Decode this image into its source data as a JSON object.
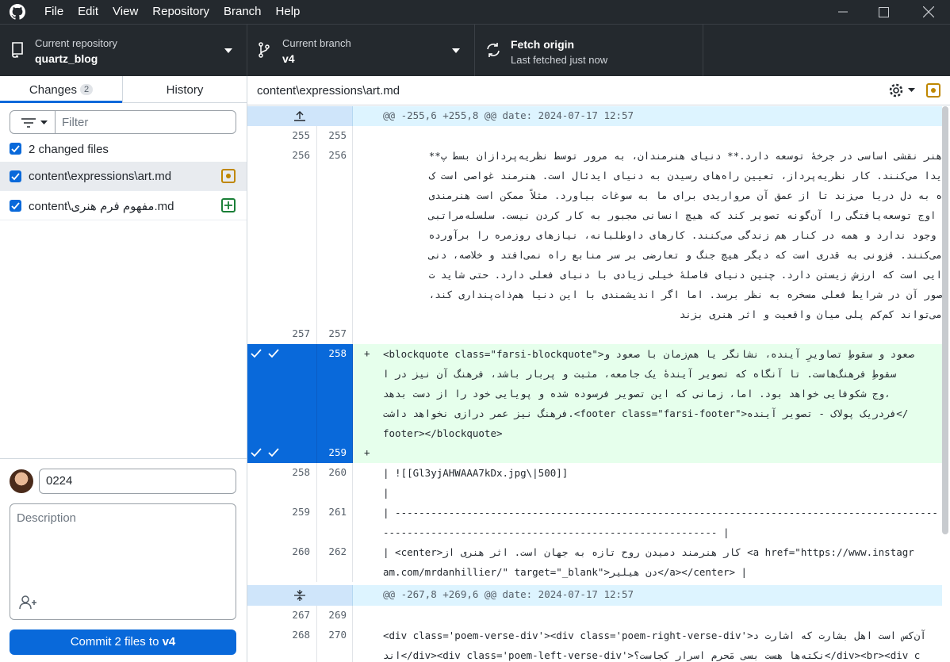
{
  "menu": [
    "File",
    "Edit",
    "View",
    "Repository",
    "Branch",
    "Help"
  ],
  "toolbar": {
    "repo_label": "Current repository",
    "repo_name": "quartz_blog",
    "branch_label": "Current branch",
    "branch_name": "v4",
    "fetch_title": "Fetch origin",
    "fetch_sub": "Last fetched just now"
  },
  "sidebar": {
    "tab_changes": "Changes",
    "changes_count": "2",
    "tab_history": "History",
    "filter_placeholder": "Filter",
    "changed_files_label": "2 changed files",
    "files": [
      {
        "name": "content\\expressions\\art.md",
        "status": "modified"
      },
      {
        "name": "content\\مفهوم فرم هنری.md",
        "status": "added"
      }
    ],
    "summary_value": "0224",
    "description_placeholder": "Description",
    "commit_prefix": "Commit 2 files to ",
    "commit_branch": "v4"
  },
  "diff": {
    "path": "content\\expressions\\art.md",
    "hunk1": "@@ -255,6 +255,8 @@ date: 2024-07-17 12:57",
    "hunk2": "@@ -267,8 +269,6 @@ date: 2024-07-17 12:57",
    "rows": [
      {
        "old": "255",
        "new": "255",
        "lines": [
          ""
        ]
      },
      {
        "old": "256",
        "new": "256",
        "lines": [
          "هنر نقشی اساسی در جرخهٔ توسعه دارد.** دنیای هنرمندان، به مرور توسط نظریه‌پردازان بسط پ**",
          "یدا می‌کنند. کار نظریه‌پرداز، تعیین راه‌های رسیدن به دنیای ایدئال است. هنرمند غواصی است ک",
          "ه به دل دریا می‌زند تا از عمق آن مرواریدی برای ما به سوغات بیاورد. مثلاً ممکن است هنرمندی",
          " اوج توسعه‌یافتگی را آن‌گونه تصویر کند که هیچ انسانی مجبور به کار کردن نیست. سلسله‌مراتبی",
          " وجود ندارد و همه در کنار هم زندگی می‌کنند. کارهای داوطلبانه، نیازهای روزمره را برآورده",
          "می‌کنند. فزونی به قدری است که دیگر هیچ جنگ و تعارضی بر سر منابع راه نمی‌افتد و خلاصه، دنی",
          "ایی است که ارزش زیستن دارد. چنین دنیای فاصلهٔ خیلی زیادی با دنیای فعلی دارد. حتی شاید ت",
          "صور آن در شرایط فعلی مسخره به نظر برسد. اما اگر اندیشمندی با این دنیا هم‌ذات‌پنداری کند،",
          "می‌تواند کم‌کم پلی میان واقعیت و اثر هنری بزند"
        ]
      },
      {
        "old": "257",
        "new": "257",
        "lines": [
          ""
        ]
      },
      {
        "old": "",
        "new": "258",
        "added": true,
        "lines": [
          "<blockquote class=\"farsi-blockquote\">صعود و سقوطِ تصاویرِ آینده، نشانگر یا هم‌زمان با صعود و",
          "سقوطِ فرهنگ‌هاست. تا آنگاه که تصویر آیندهٔ یک جامعه، مثبت و پربار باشد، فرهنگ آن نیز در ا",
          "وج شکوفایی خواهد بود. اما، زمانی که این تصویر فرسوده شده و پویایی خود را از دست بدهد،",
          "فرهنگ نیز عمر درازی نخواهد داشت.<footer class=\"farsi-footer\">فردریک پولاک - تصویر آینده</",
          "footer></blockquote>"
        ]
      },
      {
        "old": "",
        "new": "259",
        "added": true,
        "lines": [
          ""
        ]
      },
      {
        "old": "258",
        "new": "260",
        "lines": [
          "| ![[Gl3yjAHWAAA7kDx.jpg\\|500]]"
        ]
      },
      {
        "old": "",
        "new": "",
        "lines": [
          "|"
        ]
      },
      {
        "old": "259",
        "new": "261",
        "lines": [
          "| -------------------------------------------------------------------------------------------",
          "-------------------------------------------------------- |"
        ]
      },
      {
        "old": "260",
        "new": "262",
        "lines": [
          "| <center>کار هنرمند دمیدن روح تازه به جهان است. اثر هنری از <a href=\"https://www.instagr",
          "am.com/mrdanhillier/\" target=\"_blank\">دن هیلیر</a></center> |"
        ]
      },
      {
        "old": "267",
        "new": "269",
        "lines": [
          ""
        ]
      },
      {
        "old": "268",
        "new": "270",
        "lines": [
          "<div class='poem-verse-div'><div class='poem-right-verse-div'>آن‌کس است اهل بشارت که اشارت د",
          "اند</div><div class='poem-left-verse-div'>نکته‌ها هست بسی مَحرم اسرار کجاست؟</div><br><div c"
        ]
      }
    ]
  }
}
